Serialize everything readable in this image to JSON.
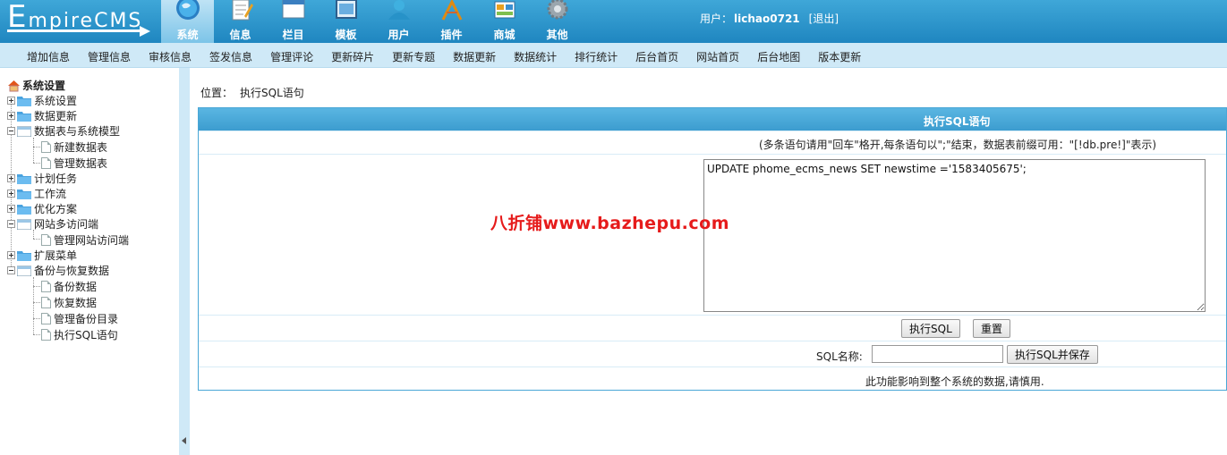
{
  "logo": {
    "first": "E",
    "rest": "mpireCMS"
  },
  "nav": [
    {
      "label": "系统",
      "icon": "globe-icon",
      "active": true
    },
    {
      "label": "信息",
      "icon": "notepad-icon"
    },
    {
      "label": "栏目",
      "icon": "window-icon"
    },
    {
      "label": "模板",
      "icon": "template-icon"
    },
    {
      "label": "用户",
      "icon": "user-icon"
    },
    {
      "label": "插件",
      "icon": "tools-icon"
    },
    {
      "label": "商城",
      "icon": "shop-icon"
    },
    {
      "label": "其他",
      "icon": "gear-icon"
    }
  ],
  "user": {
    "prefix": "用户：",
    "name": "lichao0721",
    "logout": "[退出]"
  },
  "submenu": [
    "增加信息",
    "管理信息",
    "审核信息",
    "签发信息",
    "管理评论",
    "更新碎片",
    "更新专题",
    "数据更新",
    "数据统计",
    "排行统计",
    "后台首页",
    "网站首页",
    "后台地图",
    "版本更新"
  ],
  "tree": {
    "root": "系统设置",
    "items": [
      {
        "label": "系统设置",
        "type": "folder",
        "collapsed": true
      },
      {
        "label": "数据更新",
        "type": "folder",
        "collapsed": true
      },
      {
        "label": "数据表与系统模型",
        "type": "folder",
        "collapsed": false
      },
      {
        "label": "新建数据表",
        "type": "doc"
      },
      {
        "label": "管理数据表",
        "type": "doc"
      },
      {
        "label": "计划任务",
        "type": "folder",
        "collapsed": true
      },
      {
        "label": "工作流",
        "type": "folder",
        "collapsed": true
      },
      {
        "label": "优化方案",
        "type": "folder",
        "collapsed": true
      },
      {
        "label": "网站多访问端",
        "type": "folder",
        "collapsed": false
      },
      {
        "label": "管理网站访问端",
        "type": "doc"
      },
      {
        "label": "扩展菜单",
        "type": "folder",
        "collapsed": true
      },
      {
        "label": "备份与恢复数据",
        "type": "folder",
        "collapsed": false
      },
      {
        "label": "备份数据",
        "type": "doc"
      },
      {
        "label": "恢复数据",
        "type": "doc"
      },
      {
        "label": "管理备份目录",
        "type": "doc"
      },
      {
        "label": "执行SQL语句",
        "type": "doc"
      }
    ]
  },
  "position": {
    "label": "位置：",
    "current": "执行SQL语句"
  },
  "panel": {
    "title": "执行SQL语句",
    "hint": "(多条语句请用\"回车\"格开,每条语句以\";\"结束，数据表前缀可用：\"[!db.pre!]\"表示)",
    "sql": "UPDATE phome_ecms_news SET newstime ='1583405675';",
    "run_button": "执行SQL",
    "reset_button": "重置",
    "name_label": "SQL名称:",
    "name_value": "",
    "run_save_button": "执行SQL并保存",
    "warning": "此功能影响到整个系统的数据,请慎用."
  },
  "watermark": "八折铺www.bazhepu.com",
  "colors": {
    "topbar": "#2b95cc",
    "submenu": "#cfe9f7",
    "panel_header": "#4aa7d6",
    "watermark": "#e61b1b"
  }
}
